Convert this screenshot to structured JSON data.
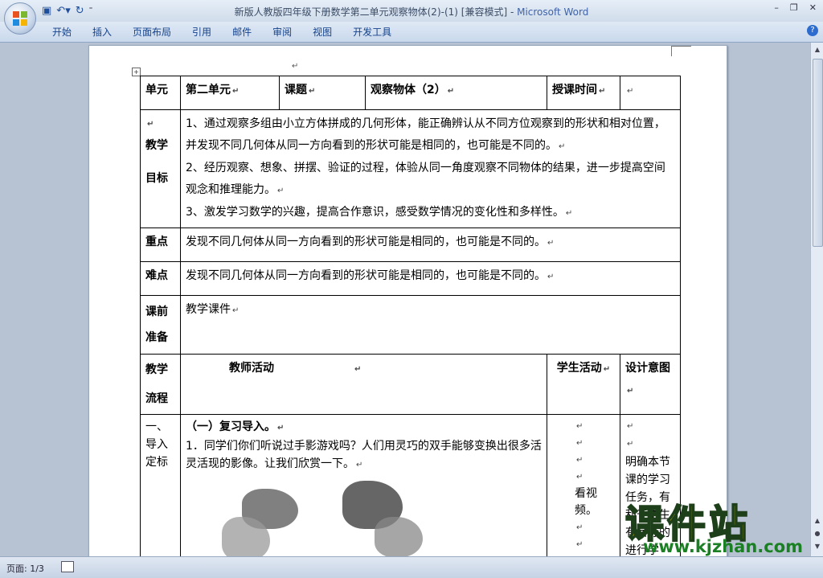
{
  "window": {
    "title": "新版人教版四年级下册数学第二单元观察物体(2)-(1) [兼容模式] - ",
    "app_name": "Microsoft Word"
  },
  "ribbon_tabs": [
    "开始",
    "插入",
    "页面布局",
    "引用",
    "邮件",
    "审阅",
    "视图",
    "开发工具"
  ],
  "status": {
    "page": "页面: 1/3"
  },
  "lesson": {
    "unit_label": "单元",
    "unit_value": "第二单元",
    "topic_label": "课题",
    "topic_value": "观察物体（2）",
    "time_label": "授课时间",
    "goals_label_1": "教学",
    "goals_label_2": "目标",
    "goal_1": "1、通过观察多组由小立方体拼成的几何形体，能正确辨认从不同方位观察到的形状和相对位置，并发现不同几何体从同一方向看到的形状可能是相同的，也可能是不同的。",
    "goal_2": "2、经历观察、想象、拼摆、验证的过程，体验从同一角度观察不同物体的结果，进一步提高空间观念和推理能力。",
    "goal_3": "3、激发学习数学的兴趣，提高合作意识，感受数学情况的变化性和多样性。",
    "key_label": "重点",
    "key_value": "发现不同几何体从同一方向看到的形状可能是相同的，也可能是不同的。",
    "difficulty_label": "难点",
    "difficulty_value": "发现不同几何体从同一方向看到的形状可能是相同的，也可能是不同的。",
    "prep_label_1": "课前",
    "prep_label_2": "准备",
    "prep_value": "教学课件",
    "flow_label_1": "教学",
    "flow_label_2": "流程",
    "teacher_header": "教师活动",
    "student_header": "学生活动",
    "design_header": "设计意图",
    "step_1": "一、",
    "step_2": "导入",
    "step_3": "定标",
    "section_title": "（一）复习导入。",
    "section_text": "1．同学们你们听说过手影游戏吗？人们用灵巧的双手能够变换出很多活灵活现的影像。让我们欣赏一下。",
    "student_activity": "看视频。",
    "design_intent": "明确本节课的学习任务，有利于学生有目标的进行学"
  },
  "watermark": {
    "big": "课件站",
    "url": "www.kjzhan.com"
  }
}
